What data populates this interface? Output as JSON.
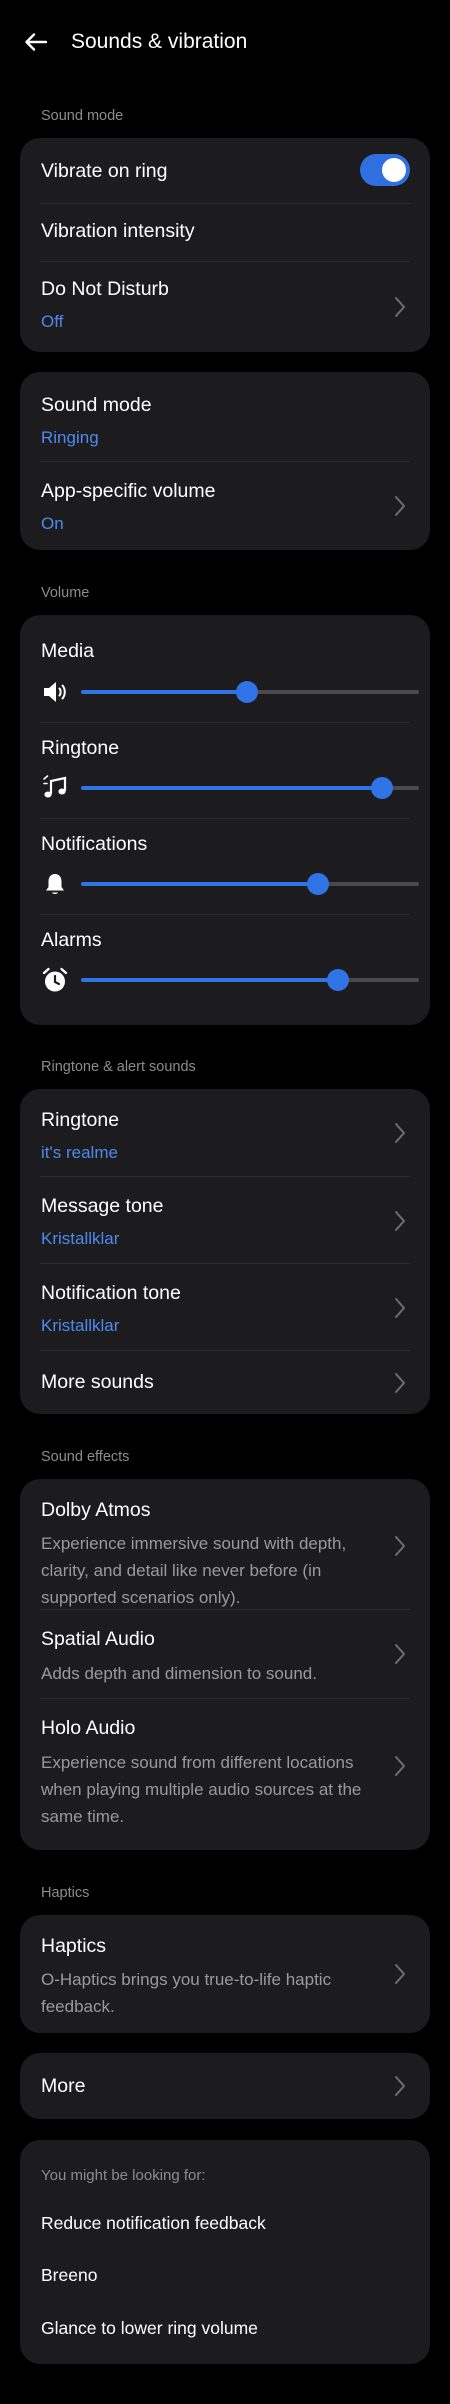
{
  "header": {
    "title": "Sounds & vibration"
  },
  "sound_mode_section": {
    "label": "Sound mode",
    "vibrate_on_ring": {
      "label": "Vibrate on ring",
      "enabled": true
    },
    "vibration_intensity": {
      "label": "Vibration intensity"
    },
    "do_not_disturb": {
      "label": "Do Not Disturb",
      "value": "Off"
    }
  },
  "mode_card": {
    "sound_mode": {
      "label": "Sound mode",
      "value": "Ringing"
    },
    "app_specific_volume": {
      "label": "App-specific volume",
      "value": "On"
    }
  },
  "volume_section": {
    "label": "Volume",
    "sliders": [
      {
        "label": "Media",
        "icon": "speaker-icon",
        "level": 0.49
      },
      {
        "label": "Ringtone",
        "icon": "music-note-icon",
        "level": 0.89
      },
      {
        "label": "Notifications",
        "icon": "bell-icon",
        "level": 0.7
      },
      {
        "label": "Alarms",
        "icon": "alarm-clock-icon",
        "level": 0.76
      }
    ]
  },
  "ringtone_section": {
    "label": "Ringtone & alert sounds",
    "ringtone": {
      "label": "Ringtone",
      "value": "it's realme"
    },
    "message_tone": {
      "label": "Message tone",
      "value": "Kristallklar"
    },
    "notification_tone": {
      "label": "Notification tone",
      "value": "Kristallklar"
    },
    "more_sounds": {
      "label": "More sounds"
    }
  },
  "effects_section": {
    "label": "Sound effects",
    "dolby": {
      "label": "Dolby Atmos",
      "desc": "Experience immersive sound with depth, clarity, and detail like never before (in supported scenarios only)."
    },
    "spatial": {
      "label": "Spatial Audio",
      "desc": "Adds depth and dimension to sound."
    },
    "holo": {
      "label": "Holo Audio",
      "desc": "Experience sound from different locations when playing multiple audio sources at the same time."
    }
  },
  "haptics_section": {
    "label": "Haptics",
    "haptics": {
      "label": "Haptics",
      "desc": "O-Haptics brings you true-to-life haptic feedback."
    }
  },
  "more": {
    "label": "More"
  },
  "suggestions": {
    "label": "You might be looking for:",
    "items": [
      "Reduce notification feedback",
      "Breeno",
      "Glance to lower ring volume"
    ]
  },
  "colors": {
    "accent": "#2f73e6",
    "card": "#1c1c1e",
    "background": "#000000",
    "link": "#4d8af0"
  }
}
